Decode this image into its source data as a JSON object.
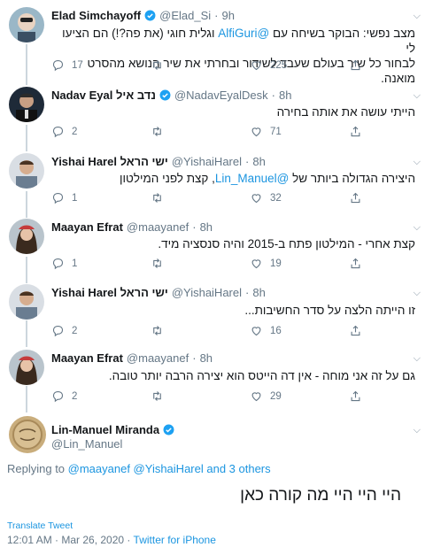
{
  "thread": [
    {
      "name": "Elad Simchayoff",
      "verified": true,
      "handle": "@Elad_Si",
      "time": "9h",
      "text_before": "מצב נפשי: הבוקר בשיחה עם ",
      "mention": "@AlfiGuri",
      "text_after": " וגלית חוגי (את פה?!) הם הציעו לי",
      "line2": "לבחור כל שיר בעולם שעבד לשידור ובחרתי את שיר הנושא מהסרט מואנה.",
      "replies": "17",
      "retweets": "",
      "likes": "225"
    },
    {
      "name": "Nadav Eyal נדב איל",
      "verified": true,
      "handle": "@NadavEyalDesk",
      "time": "8h",
      "text": "הייתי עושה את אותה בחירה",
      "replies": "2",
      "retweets": "",
      "likes": "71"
    },
    {
      "name": "Yishai Harel ישי הראל",
      "verified": false,
      "handle": "@YishaiHarel",
      "time": "8h",
      "text_before": "היצירה הגדולה ביותר של ",
      "mention": "@Lin_Manuel",
      "text_after": ", קצת לפני המילטון",
      "replies": "1",
      "retweets": "",
      "likes": "32"
    },
    {
      "name": "Maayan Efrat",
      "verified": false,
      "handle": "@maayanef",
      "time": "8h",
      "text": "קצת אחרי - המילטון פתח ב-2015 והיה סנסציה מיד.",
      "replies": "1",
      "retweets": "",
      "likes": "19"
    },
    {
      "name": "Yishai Harel ישי הראל",
      "verified": false,
      "handle": "@YishaiHarel",
      "time": "8h",
      "text": "זו הייתה הלצה על סדר החשיבות...",
      "replies": "2",
      "retweets": "",
      "likes": "16"
    },
    {
      "name": "Maayan Efrat",
      "verified": false,
      "handle": "@maayanef",
      "time": "8h",
      "text": "גם על זה אני מוחה - אין דה הייטס הוא יצירה הרבה יותר טובה.",
      "replies": "2",
      "retweets": "",
      "likes": "29"
    }
  ],
  "main": {
    "name": "Lin-Manuel Miranda",
    "verified": true,
    "handle": "@Lin_Manuel",
    "replying_prefix": "Replying to ",
    "replying_users": "@maayanef @YishaiHarel and 3 others",
    "text": "היי היי היי מה קורה כאן",
    "translate": "Translate Tweet",
    "time_date": "12:01 AM · Mar 26, 2020 · ",
    "source": "Twitter for iPhone"
  },
  "colors": {
    "link": "#1b95e0",
    "secondary_text": "#657786",
    "thread_line": "#ccd6dd"
  },
  "icons": [
    "reply-icon",
    "retweet-icon",
    "like-icon",
    "share-icon",
    "verified-badge-icon",
    "chevron-down-icon"
  ]
}
